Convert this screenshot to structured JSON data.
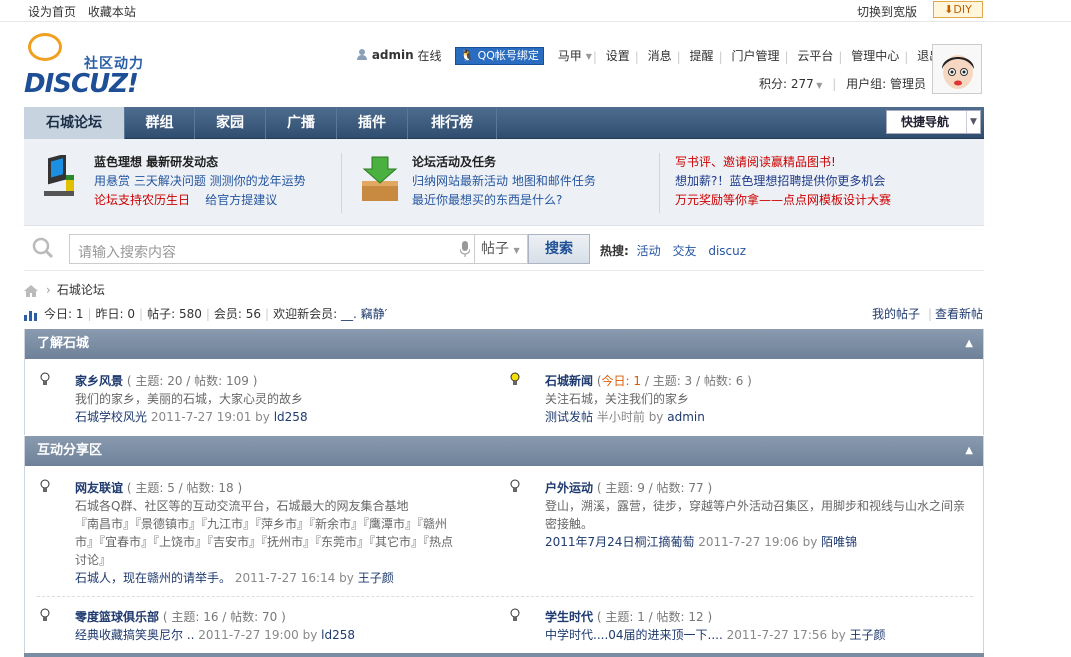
{
  "topbar": {
    "set_home": "设为首页",
    "bookmark": "收藏本站",
    "switch_wide": "切换到宽版",
    "diy": "DIY"
  },
  "logo": {
    "cn": "社区动力",
    "en": "DISCUZ!"
  },
  "user": {
    "name": "admin",
    "status": "在线",
    "qq_bind": "QQ帐号绑定",
    "menu": [
      "马甲",
      "设置",
      "消息",
      "提醒",
      "门户管理",
      "云平台",
      "管理中心",
      "退出"
    ],
    "points_label": "积分: 277",
    "usergroup_label": "用户组: 管理员"
  },
  "nav": {
    "items": [
      "石城论坛",
      "群组",
      "家园",
      "广播",
      "插件",
      "排行榜"
    ],
    "quick_nav": "快捷导航"
  },
  "ad": {
    "col1": {
      "title": "蓝色理想 最新研发动态",
      "l1": "用悬赏 三天解决问题 测测你的龙年运势",
      "l2a": "论坛支持农历生日",
      "l2b": "给官方提建议"
    },
    "col2": {
      "title": "论坛活动及任务",
      "l1": "归纳网站最新活动 地图和邮件任务",
      "l2": "最近你最想买的东西是什么?"
    },
    "col3": {
      "l1": "写书评、邀请阅读赢精品图书!",
      "l2": "想加薪?！蓝色理想招聘提供你更多机会",
      "l3": "万元奖励等你拿——点点网模板设计大赛"
    }
  },
  "search": {
    "placeholder": "请输入搜索内容",
    "type": "帖子",
    "button": "搜索",
    "hot_label": "热搜:",
    "hot": [
      "活动",
      "交友",
      "discuz"
    ]
  },
  "breadcrumb": {
    "current": "石城论坛"
  },
  "stats": {
    "today": "今日: 1",
    "yesterday": "昨日: 0",
    "posts": "帖子: 580",
    "members": "会员: 56",
    "welcome": "欢迎新会员:",
    "newuser": "__. 竊静′",
    "my_posts": "我的帖子",
    "new_posts": "查看新帖"
  },
  "groups": [
    {
      "title": "了解石城",
      "forums": [
        {
          "name": "家乡风景",
          "counts": "( 主题: 20 / 帖数: 109 )",
          "desc": "我们的家乡，美丽的石城，大家心灵的故乡",
          "last_title": "石城学校风光",
          "last_time": "2011-7-27 19:01",
          "by": "by",
          "last_user": "ld258"
        },
        {
          "name": "石城新闻",
          "today": "今日: 1",
          "counts": " / 主题: 3 / 帖数: 6 )",
          "open": "(",
          "desc": "关注石城，关注我们的家乡",
          "last_title": "测试发帖",
          "last_time": "半小时前",
          "by": "by",
          "last_user": "admin"
        }
      ]
    },
    {
      "title": "互动分享区",
      "forums": [
        {
          "name": "网友联谊",
          "counts": "( 主题: 5 / 帖数: 18 )",
          "desc1": "石城各Q群、社区等的互动交流平台，石城最大的网友集合基地",
          "desc2": "『南昌市』『景德镇市』『九江市』『萍乡市』『新余市』『鹰潭市』『赣州",
          "desc3": "市』『宜春市』『上饶市』『吉安市』『抚州市』『东莞市』『其它市』『热点",
          "desc4": "讨论』",
          "last_title": "石城人，现在赣州的请举手。",
          "last_time": "2011-7-27 16:14",
          "by": "by",
          "last_user": "王子颜"
        },
        {
          "name": "户外运动",
          "counts": "( 主题: 9 / 帖数: 77 )",
          "desc1": "登山，溯溪，露营，徒步，穿越等户外活动召集区，用脚步和视线与山水之间亲",
          "desc2": "密接触。",
          "last_title": "2011年7月24日桐江摘葡萄",
          "last_time": "2011-7-27 19:06",
          "by": "by",
          "last_user": "陌唯锦"
        },
        {
          "name": "零度篮球俱乐部",
          "counts": "( 主题: 16 / 帖数: 70 )",
          "last_title": "经典收藏搞笑奥尼尔 ..",
          "last_time": "2011-7-27 19:00",
          "by": "by",
          "last_user": "ld258"
        },
        {
          "name": "学生时代",
          "counts": "( 主题: 1 / 帖数: 12 )",
          "last_title": "中学时代....04届的进来顶一下....",
          "last_time": "2011-7-27 17:56",
          "by": "by",
          "last_user": "王子颜"
        }
      ]
    }
  ]
}
